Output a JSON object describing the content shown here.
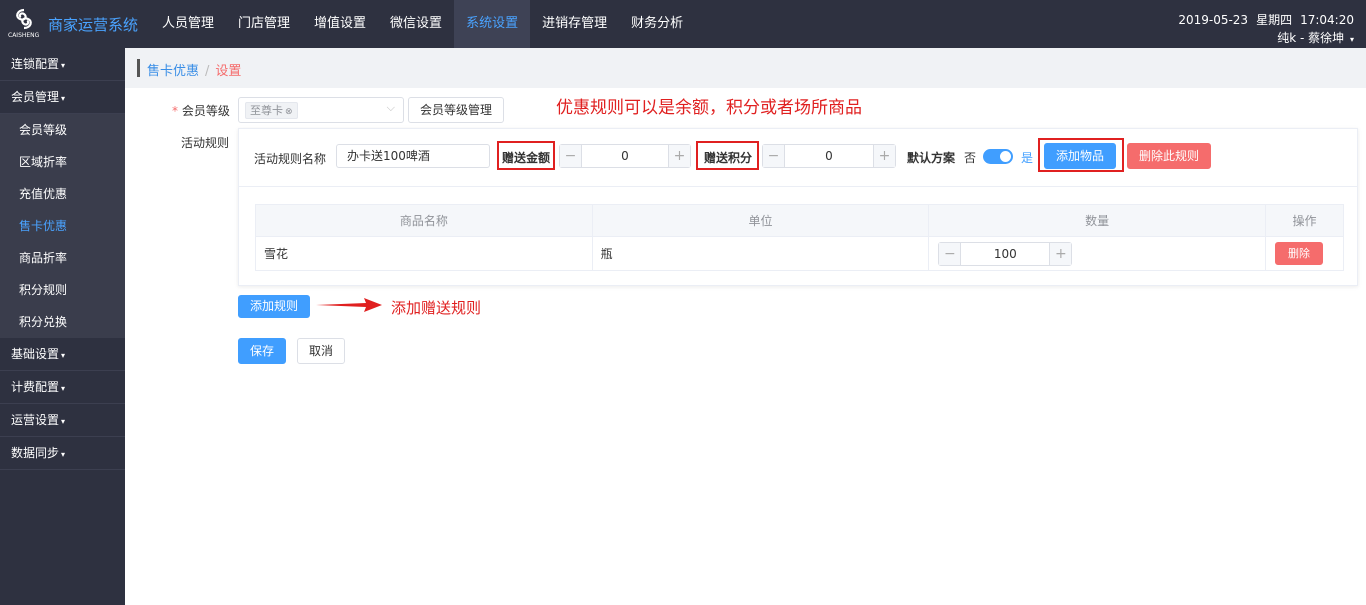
{
  "app": {
    "logo_text": "CAISHENG",
    "brand": "商家运营系统"
  },
  "topnav": [
    "人员管理",
    "门店管理",
    "增值设置",
    "微信设置",
    "系统设置",
    "进销存管理",
    "财务分析"
  ],
  "topnav_active": "系统设置",
  "header": {
    "date": "2019-05-23",
    "weekday": "星期四",
    "time": "17:04:20",
    "user": "纯k - 蔡徐坤",
    "caret": "▾"
  },
  "sidebar": {
    "groups": [
      {
        "label": "连锁配置",
        "caret": "▾"
      },
      {
        "label": "会员管理",
        "caret": "▾",
        "items": [
          "会员等级",
          "区域折率",
          "充值优惠",
          "售卡优惠",
          "商品折率",
          "积分规则",
          "积分兑换"
        ],
        "active": "售卡优惠"
      },
      {
        "label": "基础设置",
        "caret": "▾"
      },
      {
        "label": "计费配置",
        "caret": "▾"
      },
      {
        "label": "运营设置",
        "caret": "▾"
      },
      {
        "label": "数据同步",
        "caret": "▾"
      }
    ]
  },
  "breadcrumb": {
    "parent": "售卡优惠",
    "sep": "/",
    "current": "设置"
  },
  "form": {
    "member_level_label": "会员等级",
    "required_mark": "*",
    "member_level_tag": "至尊卡",
    "tag_close": "⊗",
    "select_arrow": "⌵",
    "member_level_manage_btn": "会员等级管理",
    "activity_rules_label": "活动规则",
    "rule_name_label": "活动规则名称",
    "rule_name_value": "办卡送100啤酒",
    "gift_amount_label": "赠送金额",
    "gift_amount_value": "0",
    "gift_points_label": "赠送积分",
    "gift_points_value": "0",
    "default_plan_label": "默认方案",
    "default_no": "否",
    "default_yes": "是",
    "add_goods_btn": "添加物品",
    "delete_rule_btn": "删除此规则",
    "stepper_minus": "−",
    "stepper_plus": "+",
    "table": {
      "headers": [
        "商品名称",
        "单位",
        "数量",
        "操作"
      ],
      "rows": [
        {
          "name": "雪花",
          "unit": "瓶",
          "qty": "100",
          "action": "删除"
        }
      ]
    },
    "add_rule_btn": "添加规则",
    "save_btn": "保存",
    "cancel_btn": "取消"
  },
  "annotations": {
    "top_note": "优惠规则可以是余额，积分或者场所商品",
    "add_rule_note": "添加赠送规则"
  },
  "colors": {
    "nav_bg": "#2e3140",
    "accent": "#409eff",
    "danger": "#f56c6c",
    "annotation": "#e02020"
  }
}
